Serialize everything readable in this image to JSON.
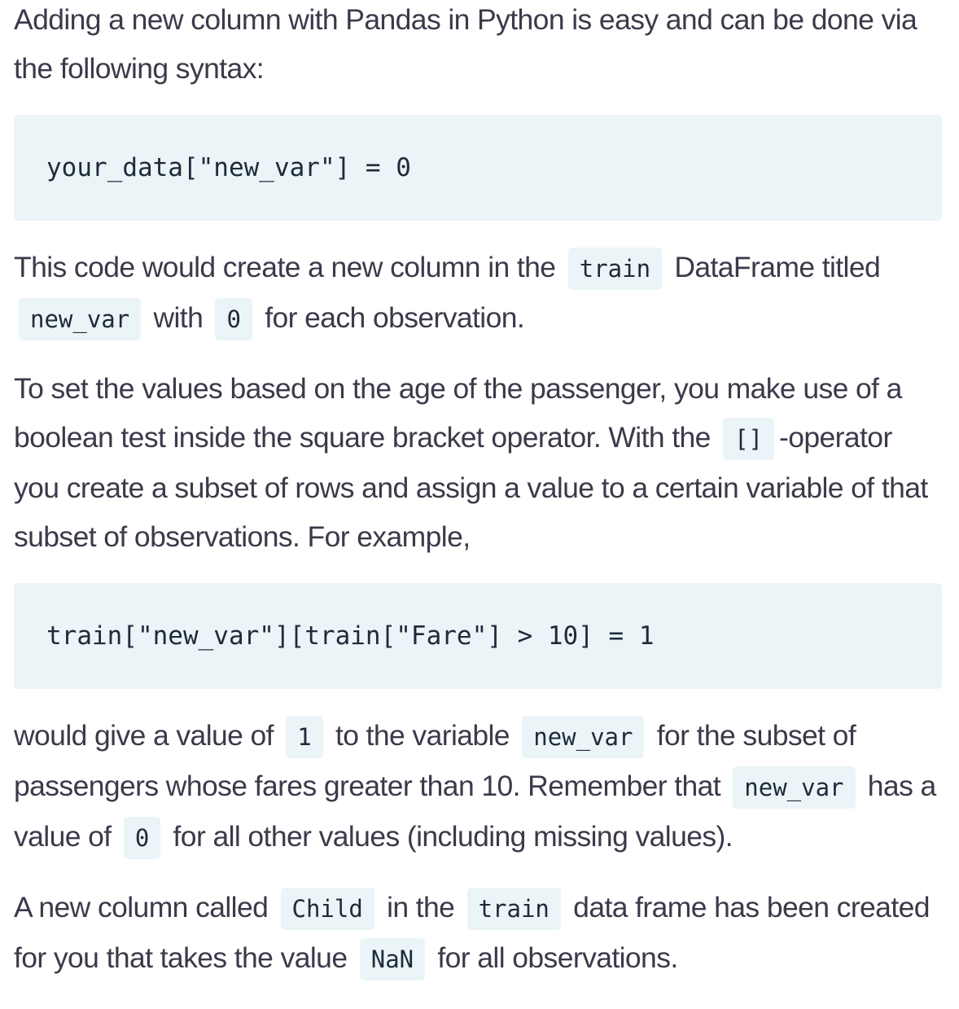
{
  "para1": {
    "text": "Adding a new column with Pandas in Python is easy and can be done via the following syntax:"
  },
  "code1": "your_data[\"new_var\"] = 0",
  "para2": {
    "t1": "This code would create a new column in the",
    "c1": "train",
    "t2": "DataFrame titled",
    "c2": "new_var",
    "t3": "with",
    "c3": "0",
    "t4": "for each observation."
  },
  "para3": {
    "t1": "To set the values based on the age of the passenger, you make use of a boolean test inside the square bracket operator. With the",
    "c1": "[]",
    "t2": "-operator you create a subset of rows and assign a value to a certain variable of that subset of observations. For example,"
  },
  "code2": "train[\"new_var\"][train[\"Fare\"] > 10] = 1",
  "para4": {
    "t1": "would give a value of",
    "c1": "1",
    "t2": "to the variable",
    "c2": "new_var",
    "t3": "for the subset of passengers whose fares greater than 10. Remember that",
    "c3": "new_var",
    "t4": "has a value of",
    "c4": "0",
    "t5": "for all other values (including missing values)."
  },
  "para5": {
    "t1": "A new column called",
    "c1": "Child",
    "t2": "in the",
    "c2": "train",
    "t3": "data frame has been created for you that takes the value",
    "c3": "NaN",
    "t4": "for all observations."
  }
}
